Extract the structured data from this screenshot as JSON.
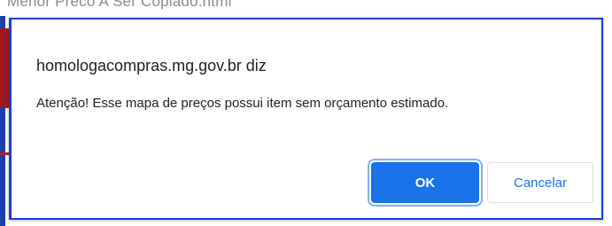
{
  "background": {
    "url_text": "Menor Preco A Ser Copiado.html"
  },
  "dialog": {
    "origin": "homologacompras.mg.gov.br diz",
    "message": "Atenção! Esse mapa de preços possui item sem orçamento estimado.",
    "ok_label": "OK",
    "cancel_label": "Cancelar"
  },
  "colors": {
    "accent": "#1a73e8",
    "dialog_border": "#1a3bd1"
  }
}
